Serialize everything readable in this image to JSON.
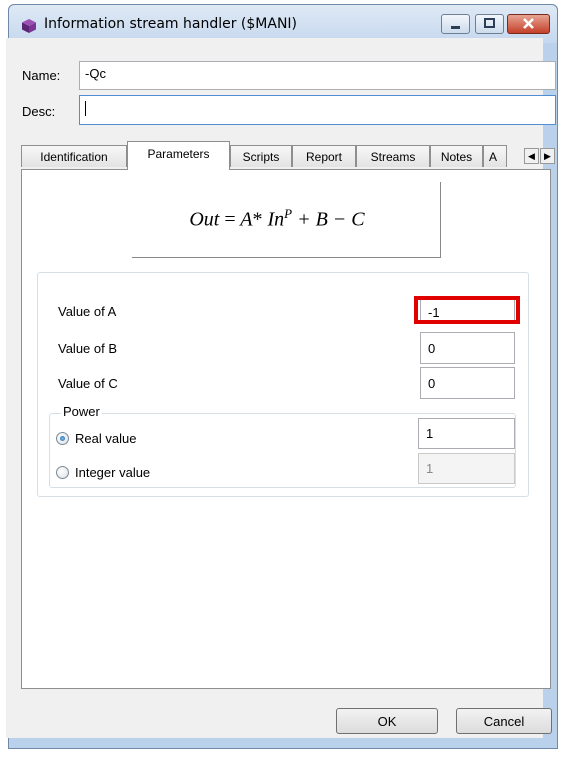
{
  "window": {
    "title": "Information stream handler ($MANI)",
    "minimize_icon": "minimize-icon",
    "maximize_icon": "maximize-icon",
    "close_icon": "close-icon",
    "app_icon": "cube-icon"
  },
  "header": {
    "name_label": "Name:",
    "name_value": "-Qc",
    "desc_label": "Desc:",
    "desc_value": ""
  },
  "tabs": [
    {
      "label": "Identification",
      "active": false
    },
    {
      "label": "Parameters",
      "active": true
    },
    {
      "label": "Scripts",
      "active": false
    },
    {
      "label": "Report",
      "active": false
    },
    {
      "label": "Streams",
      "active": false
    },
    {
      "label": "Notes",
      "active": false
    },
    {
      "label": "A",
      "active": false
    }
  ],
  "parameters": {
    "formula": {
      "lhs": "Out",
      "eq": "=",
      "a": "A",
      "star": "*",
      "in": "In",
      "exp": "P",
      "rest": "+ B − C"
    },
    "value_a_label": "Value of A",
    "value_a": "-1",
    "value_b_label": "Value of B",
    "value_b": "0",
    "value_c_label": "Value of C",
    "value_c": "0",
    "power_label": "Power",
    "real_label": "Real value",
    "real_value": "1",
    "integer_label": "Integer value",
    "integer_value": "1",
    "selected_power": "real"
  },
  "footer": {
    "ok_label": "OK",
    "cancel_label": "Cancel"
  },
  "colors": {
    "highlight": "#e10000",
    "window_frame": "#b9d1ea"
  }
}
